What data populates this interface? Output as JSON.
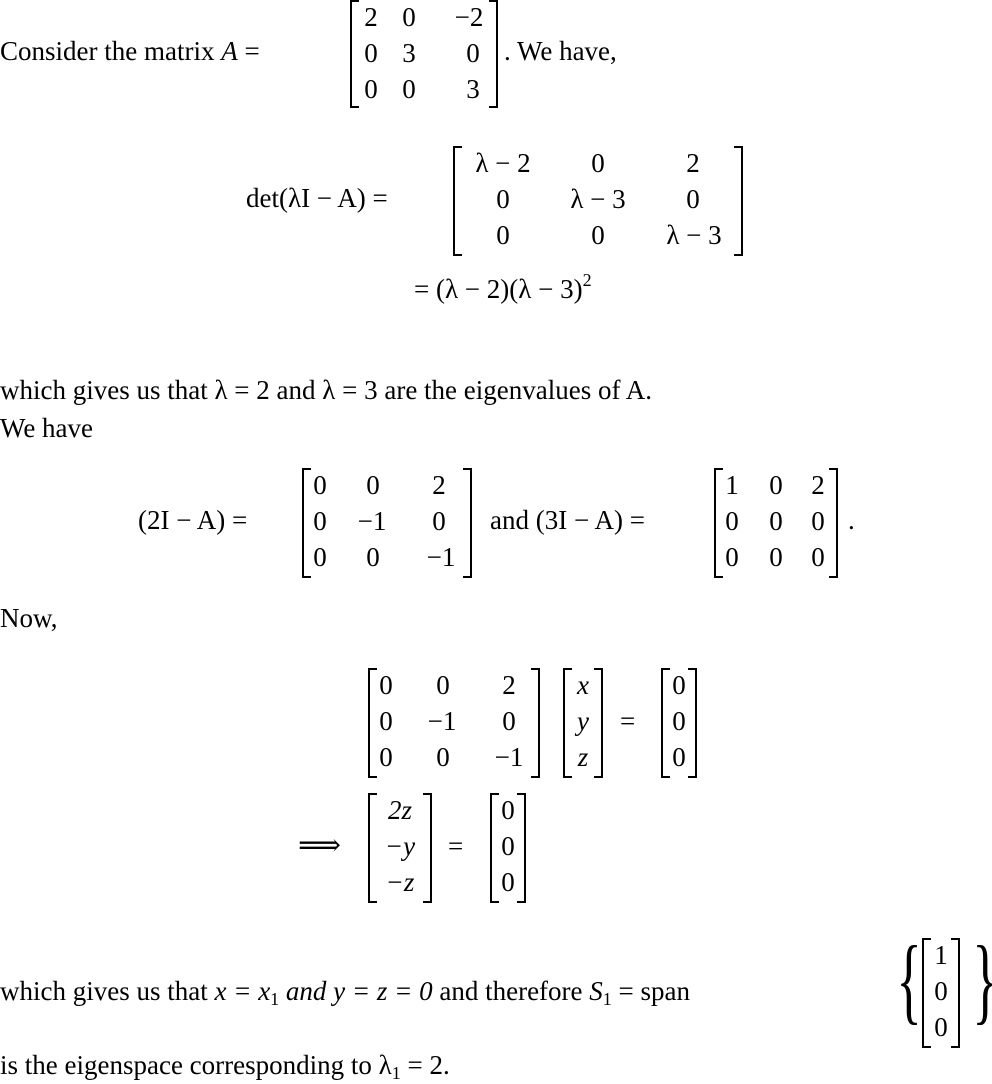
{
  "intro": {
    "lead": "Consider the matrix",
    "var": "A",
    "eq": "=",
    "tail": ". We have,",
    "matrix": [
      [
        "2",
        "0",
        "−2"
      ],
      [
        "0",
        "3",
        "0"
      ],
      [
        "0",
        "0",
        "3"
      ]
    ]
  },
  "det": {
    "lhs": "det(λI − A) =",
    "matrix": [
      [
        "λ − 2",
        "0",
        "2"
      ],
      [
        "0",
        "λ − 3",
        "0"
      ],
      [
        "0",
        "0",
        "λ − 3"
      ]
    ],
    "result_prefix": "= (λ − 2)(λ − 3)",
    "result_exp": "2"
  },
  "eigen_sentence": "which gives us that λ = 2 and λ = 3 are the eigenvalues of A.",
  "we_have": "We have",
  "pair": {
    "lhs1": "(2I − A) =",
    "m1": [
      [
        "0",
        "0",
        "2"
      ],
      [
        "0",
        "−1",
        "0"
      ],
      [
        "0",
        "0",
        "−1"
      ]
    ],
    "mid": "and (3I − A) =",
    "m2": [
      [
        "1",
        "0",
        "2"
      ],
      [
        "0",
        "0",
        "0"
      ],
      [
        "0",
        "0",
        "0"
      ]
    ],
    "end": "."
  },
  "now": "Now,",
  "system": {
    "m": [
      [
        "0",
        "0",
        "2"
      ],
      [
        "0",
        "−1",
        "0"
      ],
      [
        "0",
        "0",
        "−1"
      ]
    ],
    "vec": [
      "x",
      "y",
      "z"
    ],
    "eq": "=",
    "zero": [
      "0",
      "0",
      "0"
    ],
    "implies": "⟹",
    "lhs2": [
      "2z",
      "−y",
      "−z"
    ],
    "eq2": "=",
    "zero2": [
      "0",
      "0",
      "0"
    ]
  },
  "conclusion": {
    "text": "which gives us that x = x₁ and y = z = 0 and therefore S₁ = span",
    "parts": {
      "p1": "which gives us that",
      "x": "x = x",
      "x_sub": "1",
      "and_it": "and",
      "yz": "y = z = 0",
      "p2": "and therefore",
      "S": "S",
      "S_sub": "1",
      "span": "= span"
    },
    "basis": [
      "1",
      "0",
      "0"
    ],
    "open_brace": "{",
    "close_brace": "}"
  },
  "final": {
    "prefix": "is the eigenspace corresponding to λ",
    "sub": "1",
    "suffix": "= 2."
  }
}
